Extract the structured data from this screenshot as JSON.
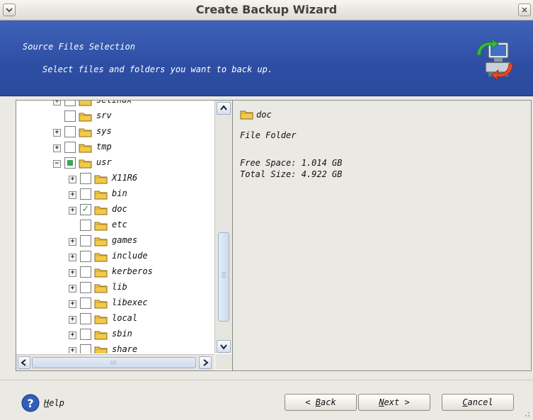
{
  "window": {
    "title": "Create Backup Wizard"
  },
  "header": {
    "title": "Source Files Selection",
    "subtitle": "Select files and folders you want to back up."
  },
  "tree": {
    "items": [
      {
        "label": "selinux",
        "expander": "plus",
        "check": "unchecked",
        "level": 0
      },
      {
        "label": "srv",
        "expander": "none",
        "check": "unchecked",
        "level": 0
      },
      {
        "label": "sys",
        "expander": "plus",
        "check": "unchecked",
        "level": 0
      },
      {
        "label": "tmp",
        "expander": "plus",
        "check": "unchecked",
        "level": 0
      },
      {
        "label": "usr",
        "expander": "minus",
        "check": "partial",
        "level": 0
      },
      {
        "label": "X11R6",
        "expander": "plus",
        "check": "unchecked",
        "level": 1
      },
      {
        "label": "bin",
        "expander": "plus",
        "check": "unchecked",
        "level": 1
      },
      {
        "label": "doc",
        "expander": "plus",
        "check": "checked",
        "level": 1
      },
      {
        "label": "etc",
        "expander": "none",
        "check": "unchecked",
        "level": 1
      },
      {
        "label": "games",
        "expander": "plus",
        "check": "unchecked",
        "level": 1
      },
      {
        "label": "include",
        "expander": "plus",
        "check": "unchecked",
        "level": 1
      },
      {
        "label": "kerberos",
        "expander": "plus",
        "check": "unchecked",
        "level": 1
      },
      {
        "label": "lib",
        "expander": "plus",
        "check": "unchecked",
        "level": 1
      },
      {
        "label": "libexec",
        "expander": "plus",
        "check": "unchecked",
        "level": 1
      },
      {
        "label": "local",
        "expander": "plus",
        "check": "unchecked",
        "level": 1
      },
      {
        "label": "sbin",
        "expander": "plus",
        "check": "unchecked",
        "level": 1
      },
      {
        "label": "share",
        "expander": "plus",
        "check": "unchecked",
        "level": 1
      }
    ]
  },
  "info": {
    "name": "doc",
    "type": "File Folder",
    "free_space": "Free Space: 1.014 GB",
    "total_size": "Total Size: 4.922 GB"
  },
  "buttons": {
    "help_letter": "H",
    "help_rest": "elp",
    "back_prefix": "< ",
    "back_letter": "B",
    "back_rest": "ack",
    "next_letter": "N",
    "next_rest": "ext >",
    "cancel_letter": "C",
    "cancel_rest": "ancel"
  },
  "colors": {
    "header": "#2d4ea3",
    "check_green": "#2f9a47",
    "folder_yellow": "#f3c94b"
  }
}
